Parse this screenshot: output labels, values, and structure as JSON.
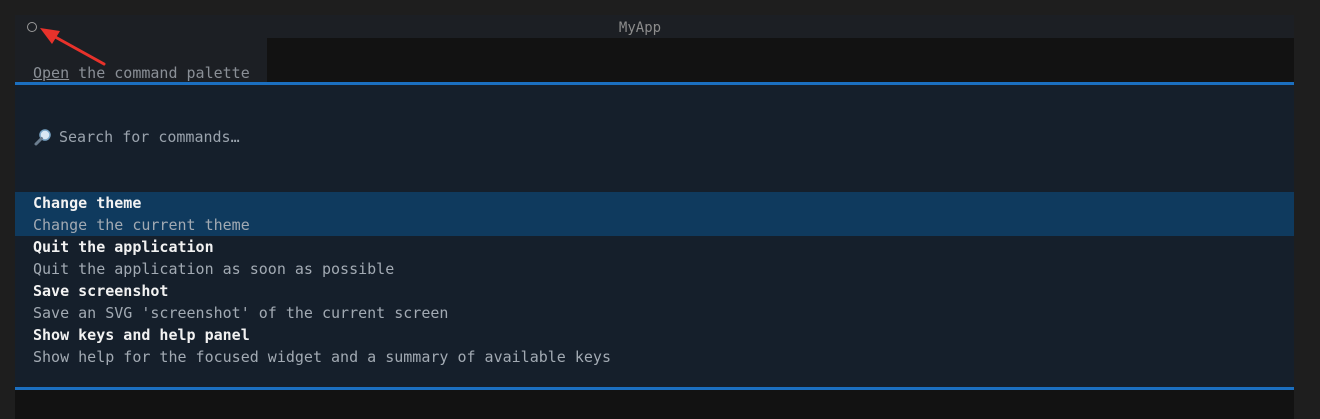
{
  "window": {
    "title": "MyApp"
  },
  "header": {
    "open_link": "Open",
    "rest_text": " the command palette"
  },
  "search": {
    "placeholder": "Search for commands…"
  },
  "commands": [
    {
      "title": "Change theme",
      "description": "Change the current theme",
      "selected": true
    },
    {
      "title": "Quit the application",
      "description": "Quit the application as soon as possible",
      "selected": false
    },
    {
      "title": "Save screenshot",
      "description": "Save an SVG 'screenshot' of the current screen",
      "selected": false
    },
    {
      "title": "Show keys and help panel",
      "description": "Show help for the focused widget and a summary of available keys",
      "selected": false
    }
  ],
  "icons": {
    "window_button": "circle-icon",
    "search": "magnifier-icon",
    "annotation": "red-arrow-icon"
  },
  "colors": {
    "accent": "#1b6fc0",
    "selected_row": "#0f3a5e",
    "palette_bg": "#151f2b",
    "annotation_arrow": "#e8322b"
  }
}
